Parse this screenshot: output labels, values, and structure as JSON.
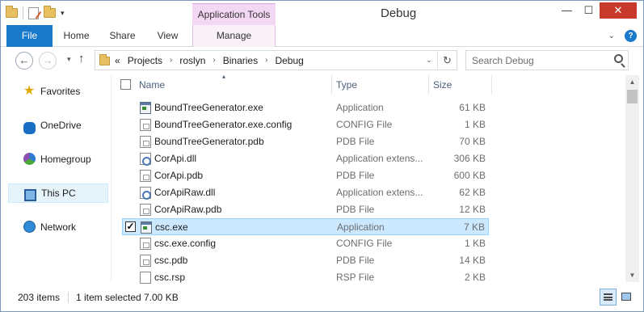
{
  "window": {
    "title": "Debug",
    "context_tab_group": "Application Tools"
  },
  "quick_access": {
    "dropdown_glyph": "▾",
    "icons": [
      "folder-icon",
      "properties-icon",
      "new-folder-icon"
    ]
  },
  "window_controls": {
    "minimize": "—",
    "maximize": "☐",
    "close": "✕"
  },
  "ribbon": {
    "tabs": [
      {
        "label": "File",
        "style": "file"
      },
      {
        "label": "Home"
      },
      {
        "label": "Share"
      },
      {
        "label": "View"
      },
      {
        "label": "Manage",
        "style": "contextual"
      }
    ],
    "expand_glyph": "⌄",
    "help_glyph": "?"
  },
  "navigation": {
    "back_glyph": "←",
    "forward_glyph": "→",
    "dropdown_glyph": "▾",
    "up_glyph": "↑",
    "address_prefix": "«",
    "breadcrumbs": [
      "Projects",
      "roslyn",
      "Binaries",
      "Debug"
    ],
    "crumb_separator": "›",
    "address_dropdown_glyph": "⌄",
    "refresh_glyph": "↻"
  },
  "search": {
    "placeholder": "Search Debug"
  },
  "nav_pane": {
    "items": [
      {
        "label": "Favorites",
        "icon": "star-icon",
        "selected": false
      },
      {
        "label": "OneDrive",
        "icon": "cloud-icon",
        "selected": false
      },
      {
        "label": "Homegroup",
        "icon": "homegroup-icon",
        "selected": false
      },
      {
        "label": "This PC",
        "icon": "computer-icon",
        "selected": true
      },
      {
        "label": "Network",
        "icon": "network-icon",
        "selected": false
      }
    ]
  },
  "columns": {
    "name": "Name",
    "type": "Type",
    "size": "Size",
    "sort_glyph": "▴"
  },
  "files": [
    {
      "name": "BoundTreeGenerator.exe",
      "type": "Application",
      "size": "61 KB",
      "icon": "app",
      "selected": false
    },
    {
      "name": "BoundTreeGenerator.exe.config",
      "type": "CONFIG File",
      "size": "1 KB",
      "icon": "doc",
      "selected": false
    },
    {
      "name": "BoundTreeGenerator.pdb",
      "type": "PDB File",
      "size": "70 KB",
      "icon": "doc",
      "selected": false
    },
    {
      "name": "CorApi.dll",
      "type": "Application extens...",
      "size": "306 KB",
      "icon": "dll",
      "selected": false
    },
    {
      "name": "CorApi.pdb",
      "type": "PDB File",
      "size": "600 KB",
      "icon": "doc",
      "selected": false
    },
    {
      "name": "CorApiRaw.dll",
      "type": "Application extens...",
      "size": "62 KB",
      "icon": "dll",
      "selected": false
    },
    {
      "name": "CorApiRaw.pdb",
      "type": "PDB File",
      "size": "12 KB",
      "icon": "doc",
      "selected": false
    },
    {
      "name": "csc.exe",
      "type": "Application",
      "size": "7 KB",
      "icon": "app",
      "selected": true
    },
    {
      "name": "csc.exe.config",
      "type": "CONFIG File",
      "size": "1 KB",
      "icon": "doc",
      "selected": false
    },
    {
      "name": "csc.pdb",
      "type": "PDB File",
      "size": "14 KB",
      "icon": "doc",
      "selected": false
    },
    {
      "name": "csc.rsp",
      "type": "RSP File",
      "size": "2 KB",
      "icon": "plain",
      "selected": false
    }
  ],
  "scrollbar": {
    "up_glyph": "▲",
    "down_glyph": "▼"
  },
  "status": {
    "item_count": "203 items",
    "selection": "1 item selected",
    "selection_size": "7.00 KB"
  },
  "colors": {
    "file_tab": "#1979ca",
    "context_tab": "#f3d8f3",
    "selection": "#cce8ff",
    "close_button": "#c7392b"
  }
}
